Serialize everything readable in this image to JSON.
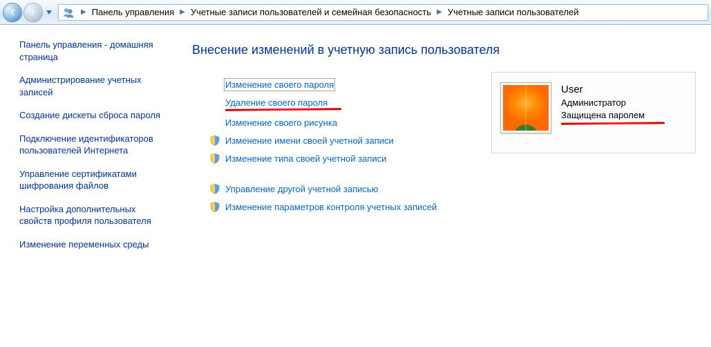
{
  "breadcrumb": {
    "items": [
      "Панель управления",
      "Учетные записи пользователей и семейная безопасность",
      "Учетные записи пользователей"
    ]
  },
  "sidebar": {
    "items": [
      "Панель управления - домашняя страница",
      "Администрирование учетных записей",
      "Создание дискеты сброса пароля",
      "Подключение идентификаторов пользователей Интернета",
      "Управление сертификатами шифрования файлов",
      "Настройка дополнительных свойств профиля пользователя",
      "Изменение переменных среды"
    ]
  },
  "main": {
    "title": "Внесение изменений в учетную запись пользователя",
    "actions": {
      "change_password": "Изменение своего пароля",
      "remove_password": "Удаление своего пароля",
      "change_picture": "Изменение своего рисунка",
      "change_name": "Изменение имени своей учетной записи",
      "change_type": "Изменение типа своей учетной записи",
      "manage_other": "Управление другой учетной записью",
      "uac_settings": "Изменение параметров контроля учетных записей"
    }
  },
  "user_card": {
    "name": "User",
    "role": "Администратор",
    "status": "Защищена паролем"
  }
}
